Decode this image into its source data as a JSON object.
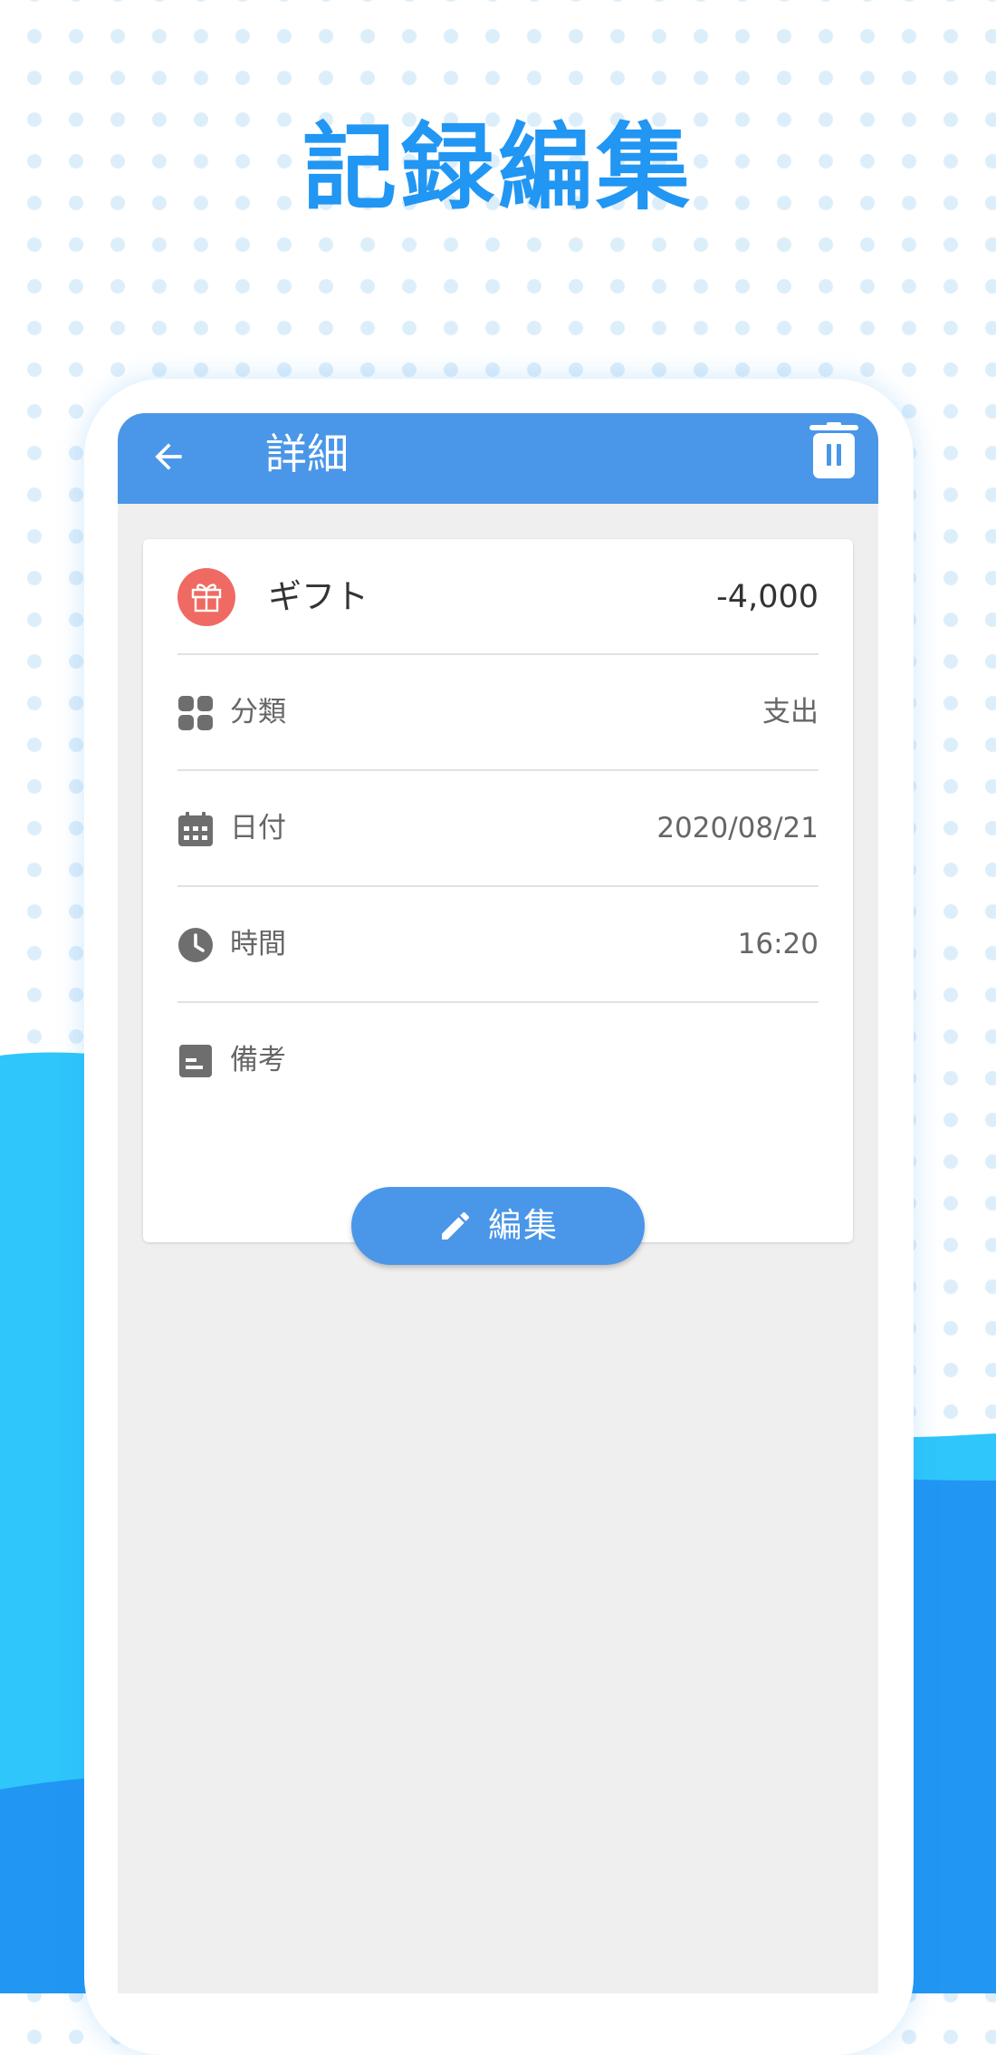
{
  "promo": {
    "title": "記録編集"
  },
  "appbar": {
    "title": "詳細",
    "back_icon": "arrow-left-icon",
    "delete_icon": "trash-icon"
  },
  "record": {
    "category_icon": "gift-icon",
    "category": "ギフト",
    "amount": "-4,000",
    "rows": [
      {
        "icon": "grid-icon",
        "label": "分類",
        "value": "支出"
      },
      {
        "icon": "calendar-icon",
        "label": "日付",
        "value": "2020/08/21"
      },
      {
        "icon": "clock-icon",
        "label": "時間",
        "value": "16:20"
      },
      {
        "icon": "note-icon",
        "label": "備考",
        "value": ""
      }
    ]
  },
  "actions": {
    "edit_icon": "pencil-icon",
    "edit_label": "編集"
  },
  "colors": {
    "accent": "#4a96e8",
    "promo_title": "#2196f3",
    "wave_light": "#2fc6fb",
    "wave_dark": "#2196f3",
    "gift_badge": "#ef6a62",
    "screen_background": "#efefef",
    "row_icon": "#6e6e6e"
  }
}
